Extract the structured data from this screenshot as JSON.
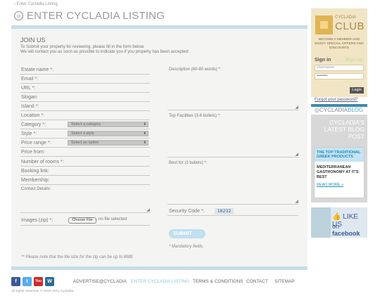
{
  "breadcrumb": "› Enter Cycladia Listing",
  "page_title": "ENTER CYCLADIA LISTING",
  "form": {
    "heading": "JOIN US",
    "intro_1": "To Submit your property for reviewing, please fill in the form below.",
    "intro_2": "We will contact you as soon as possible to indicate you if you property has been accepted:",
    "labels": {
      "estate_name": "Estate name *:",
      "email": "Email *:",
      "url": "URL *:",
      "slogan": "Slogan:",
      "island": "Island *:",
      "location": "Location *:",
      "category": "Category *:",
      "style": "Style *:",
      "price_range": "Price range *:",
      "price_from": "Price from:",
      "rooms": "Number of rooms *:",
      "booking_link": "Booking link:",
      "membership": "Membership:",
      "contact_details": "Contact Details:",
      "images": "Images (zip) *:",
      "description": "Description (60-80 words) *:",
      "top_facilities": "Top Facilities (3-6 bullets) *:",
      "best_for": "Best for (3 bullets) *:",
      "security_code": "Security Code *:"
    },
    "selects": {
      "category": "Select a category",
      "style": "Select a style",
      "price_range": "Select an option"
    },
    "file_button": "Choose File",
    "file_status": "no file selected",
    "captcha": "10232",
    "submit": "SUBMIT",
    "mandatory_note": "* Mandatory fields.",
    "zip_note": "** Please note that the file size for the zip can be up to 8MB."
  },
  "sidebar": {
    "club_name": "CYCLADIA",
    "club_big": "CLUB",
    "club_desc": "BECOME A MEMBER AND ENJOY SPECIAL OFFERS AND DISCOUNTS",
    "sign_in": "Sign in",
    "sign_up": "Sign up",
    "username_placeholder": "Username",
    "password_value": "••••••••",
    "login": "Login",
    "forgot": "Forgot your password?",
    "blog_brand_a": "CYCLADIA",
    "blog_brand_b": "BLOG",
    "blog_title": "CYCLADIA'S LATEST BLOG POST",
    "blog_kicker": "THE TOP TRADITIONAL GREEK PRODUCTS",
    "blog_headline": "MEDITERRANEAN GASTRONOMY AT IT'S BEST",
    "read_more": "READ MORE »",
    "like_line1": "LIKE US",
    "like_on": "on",
    "like_fb": "facebook"
  },
  "footer": {
    "social": [
      "f",
      "t",
      "You",
      "W"
    ],
    "nav": [
      "ADVERTISE@CYCLADIA",
      "ENTER CYCLADIA LISTING",
      "TERMS & CONDITIONS",
      "CONTACT",
      "SITEMAP"
    ],
    "copyright": "All rights reserved. © 2010-2011 Cycladia."
  },
  "colors": {
    "accent_blue": "#c5dde8",
    "club_gold": "#e0b355",
    "facebook": "#3b5998"
  }
}
